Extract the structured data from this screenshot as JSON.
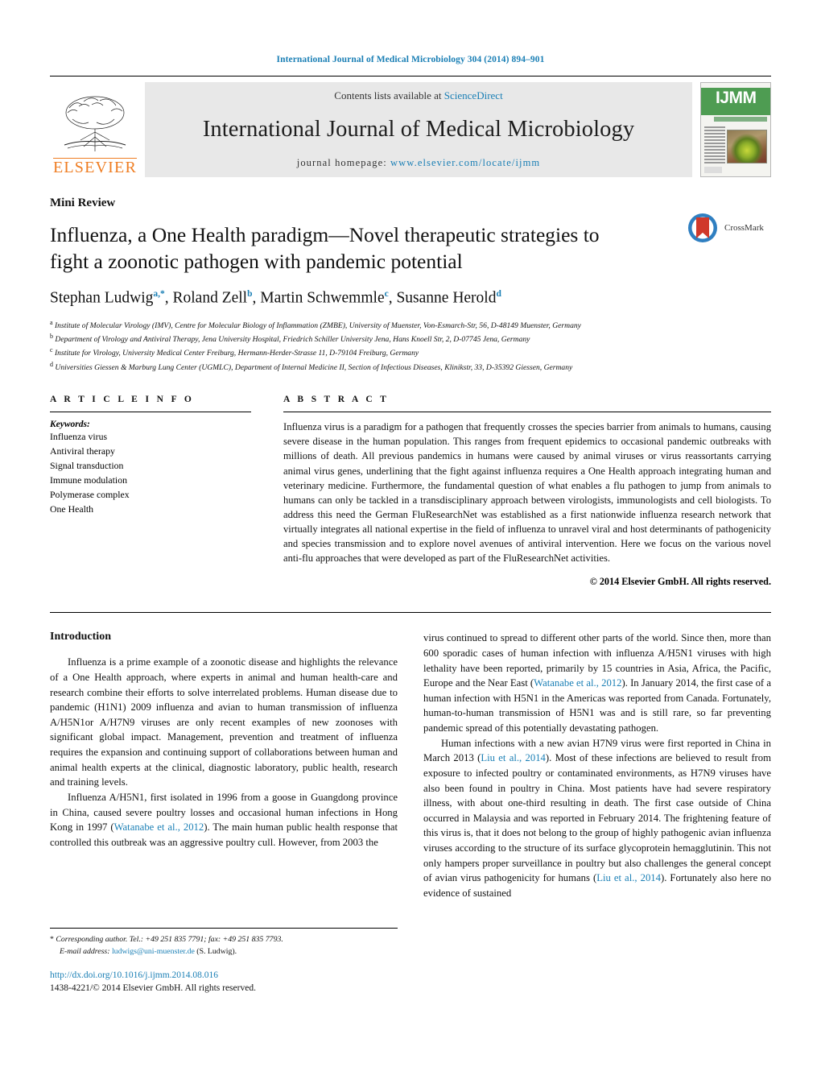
{
  "running_head": "International Journal of Medical Microbiology 304 (2014) 894–901",
  "masthead": {
    "contents_prefix": "Contents lists available at ",
    "sciencedirect": "ScienceDirect",
    "journal_name": "International Journal of Medical Microbiology",
    "homepage_label": "journal homepage: ",
    "homepage_url": "www.elsevier.com/locate/ijmm",
    "publisher": "ELSEVIER",
    "cover_title": "IJMM"
  },
  "article": {
    "type": "Mini Review",
    "title": "Influenza, a One Health paradigm—Novel therapeutic strategies to fight a zoonotic pathogen with pandemic potential",
    "crossmark_label": "CrossMark",
    "authors_html": "Stephan Ludwig<sup>a,*</sup>, Roland Zell<sup>b</sup>, Martin Schwemmle<sup>c</sup>, Susanne Herold<sup>d</sup>",
    "affiliations": [
      {
        "marker": "a",
        "text": "Institute of Molecular Virology (IMV), Centre for Molecular Biology of Inflammation (ZMBE), University of Muenster, Von-Esmarch-Str, 56, D-48149 Muenster, Germany"
      },
      {
        "marker": "b",
        "text": "Department of Virology and Antiviral Therapy, Jena University Hospital, Friedrich Schiller University Jena, Hans Knoell Str, 2, D-07745 Jena, Germany"
      },
      {
        "marker": "c",
        "text": "Institute for Virology, University Medical Center Freiburg, Hermann-Herder-Strasse 11, D-79104 Freiburg, Germany"
      },
      {
        "marker": "d",
        "text": "Universities Giessen & Marburg Lung Center (UGMLC), Department of Internal Medicine II, Section of Infectious Diseases, Klinikstr, 33, D-35392 Giessen, Germany"
      }
    ]
  },
  "article_info": {
    "heading": "A R T I C L E   I N F O",
    "keywords_label": "Keywords:",
    "keywords": [
      "Influenza virus",
      "Antiviral therapy",
      "Signal transduction",
      "Immune modulation",
      "Polymerase complex",
      "One Health"
    ]
  },
  "abstract": {
    "heading": "A B S T R A C T",
    "text": "Influenza virus is a paradigm for a pathogen that frequently crosses the species barrier from animals to humans, causing severe disease in the human population. This ranges from frequent epidemics to occasional pandemic outbreaks with millions of death. All previous pandemics in humans were caused by animal viruses or virus reassortants carrying animal virus genes, underlining that the fight against influenza requires a One Health approach integrating human and veterinary medicine. Furthermore, the fundamental question of what enables a flu pathogen to jump from animals to humans can only be tackled in a transdisciplinary approach between virologists, immunologists and cell biologists. To address this need the German FluResearchNet was established as a first nationwide influenza research network that virtually integrates all national expertise in the field of influenza to unravel viral and host determinants of pathogenicity and species transmission and to explore novel avenues of antiviral intervention. Here we focus on the various novel anti-flu approaches that were developed as part of the FluResearchNet activities.",
    "copyright": "© 2014 Elsevier GmbH. All rights reserved."
  },
  "body": {
    "intro_heading": "Introduction",
    "left_para_1": "Influenza is a prime example of a zoonotic disease and highlights the relevance of a One Health approach, where experts in animal and human health-care and research combine their efforts to solve interrelated problems. Human disease due to pandemic (H1N1) 2009 influenza and avian to human transmission of influenza A/H5N1or A/H7N9 viruses are only recent examples of new zoonoses with significant global impact. Management, prevention and treatment of influenza requires the expansion and continuing support of collaborations between human and animal health experts at the clinical, diagnostic laboratory, public health, research and training levels.",
    "left_para_2a": "Influenza A/H5N1, first isolated in 1996 from a goose in Guangdong province in China, caused severe poultry losses and occasional human infections in Hong Kong in 1997 (",
    "left_cite_1": "Watanabe et al., 2012",
    "left_para_2b": "). The main human public health response that controlled this outbreak was an aggressive poultry cull. However, from 2003 the",
    "right_para_1a": "virus continued to spread to different other parts of the world. Since then, more than 600 sporadic cases of human infection with influenza A/H5N1 viruses with high lethality have been reported, primarily by 15 countries in Asia, Africa, the Pacific, Europe and the Near East (",
    "right_cite_1": "Watanabe et al., 2012",
    "right_para_1b": "). In January 2014, the first case of a human infection with H5N1 in the Americas was reported from Canada. Fortunately, human-to-human transmission of H5N1 was and is still rare, so far preventing pandemic spread of this potentially devastating pathogen.",
    "right_para_2a": "Human infections with a new avian H7N9 virus were first reported in China in March 2013 (",
    "right_cite_2": "Liu et al., 2014",
    "right_para_2b": "). Most of these infections are believed to result from exposure to infected poultry or contaminated environments, as H7N9 viruses have also been found in poultry in China. Most patients have had severe respiratory illness, with about one-third resulting in death. The first case outside of China occurred in Malaysia and was reported in February 2014. The frightening feature of this virus is, that it does not belong to the group of highly pathogenic avian influenza viruses according to the structure of its surface glycoprotein hemagglutinin. This not only hampers proper surveillance in poultry but also challenges the general concept of avian virus pathogenicity for humans (",
    "right_cite_3": "Liu et al., 2014",
    "right_para_2c": "). Fortunately also here no evidence of sustained"
  },
  "footer": {
    "corresponding_star": "*",
    "corresponding_text": "Corresponding author. Tel.: +49 251 835 7791; fax: +49 251 835 7793.",
    "email_label": "E-mail address: ",
    "email": "ludwigs@uni-muenster.de",
    "email_suffix": " (S. Ludwig).",
    "doi": "http://dx.doi.org/10.1016/j.ijmm.2014.08.016",
    "issn_line": "1438-4221/© 2014 Elsevier GmbH. All rights reserved."
  },
  "colors": {
    "link": "#1a7fb5",
    "elsevier_orange": "#ef7d22",
    "cover_green": "#4e9c52"
  }
}
